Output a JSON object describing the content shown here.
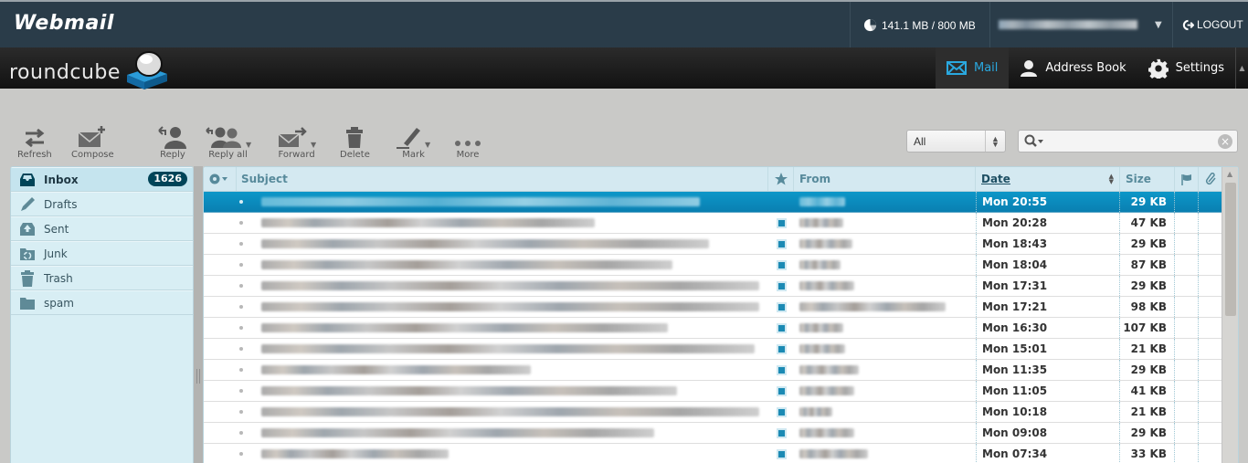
{
  "topbar": {
    "brand": "Webmail",
    "quota": "141.1 MB / 800 MB",
    "quota_icon": "pie-chart-icon",
    "username": "",
    "logout_label": "LOGOUT"
  },
  "header": {
    "logo_text": "roundcube",
    "tasks": [
      {
        "label": "Mail",
        "icon": "envelope-icon",
        "active": true
      },
      {
        "label": "Address Book",
        "icon": "person-icon",
        "active": false
      },
      {
        "label": "Settings",
        "icon": "gear-icon",
        "active": false
      }
    ]
  },
  "toolbar": {
    "refresh": "Refresh",
    "compose": "Compose",
    "reply": "Reply",
    "reply_all": "Reply all",
    "forward": "Forward",
    "delete": "Delete",
    "mark": "Mark",
    "more": "More"
  },
  "filter": {
    "selected": "All"
  },
  "search": {
    "value": "",
    "placeholder": ""
  },
  "folders": [
    {
      "name": "Inbox",
      "icon": "inbox-icon",
      "unread": "1626",
      "selected": true
    },
    {
      "name": "Drafts",
      "icon": "pencil-icon",
      "unread": "",
      "selected": false
    },
    {
      "name": "Sent",
      "icon": "sent-tray-icon",
      "unread": "",
      "selected": false
    },
    {
      "name": "Junk",
      "icon": "recycle-folder-icon",
      "unread": "",
      "selected": false
    },
    {
      "name": "Trash",
      "icon": "trash-icon",
      "unread": "",
      "selected": false
    },
    {
      "name": "spam",
      "icon": "folder-icon",
      "unread": "",
      "selected": false
    }
  ],
  "list": {
    "columns": {
      "subject": "Subject",
      "from": "From",
      "date": "Date",
      "size": "Size"
    },
    "sort_column": "Date",
    "messages": [
      {
        "date": "Mon 20:55",
        "size": "29 KB",
        "selected": true
      },
      {
        "date": "Mon 20:28",
        "size": "47 KB",
        "selected": false
      },
      {
        "date": "Mon 18:43",
        "size": "29 KB",
        "selected": false
      },
      {
        "date": "Mon 18:04",
        "size": "87 KB",
        "selected": false
      },
      {
        "date": "Mon 17:31",
        "size": "29 KB",
        "selected": false
      },
      {
        "date": "Mon 17:21",
        "size": "98 KB",
        "selected": false
      },
      {
        "date": "Mon 16:30",
        "size": "107 KB",
        "selected": false
      },
      {
        "date": "Mon 15:01",
        "size": "21 KB",
        "selected": false
      },
      {
        "date": "Mon 11:35",
        "size": "29 KB",
        "selected": false
      },
      {
        "date": "Mon 11:05",
        "size": "41 KB",
        "selected": false
      },
      {
        "date": "Mon 10:18",
        "size": "21 KB",
        "selected": false
      },
      {
        "date": "Mon 09:08",
        "size": "29 KB",
        "selected": false
      },
      {
        "date": "Mon 07:34",
        "size": "33 KB",
        "selected": false
      }
    ]
  },
  "colors": {
    "accent": "#0a8dc0",
    "topbar": "#2a3c49",
    "badge": "#004458"
  }
}
